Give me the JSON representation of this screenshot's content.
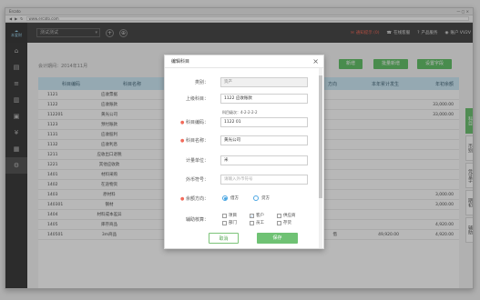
{
  "browser": {
    "tab": "Ercato",
    "url": "www.ercato.com"
  },
  "top": {
    "logo_label": "本爱财",
    "account_select": "测试测试",
    "add_btn": "+",
    "share_btn": "⊕",
    "tools": [
      {
        "label": "通知提示 (0)",
        "color": "red",
        "icon": "bell-icon"
      },
      {
        "label": "在线客服",
        "color": "light",
        "icon": "chat-icon"
      },
      {
        "label": "产品服务",
        "color": "light",
        "icon": "help-icon"
      },
      {
        "label": "账户 VV2V",
        "color": "light",
        "icon": "user-icon"
      }
    ]
  },
  "side": {
    "icons": [
      "home-icon",
      "doc-icon",
      "list-icon",
      "chart-icon",
      "book-icon",
      "money-icon",
      "gift-icon",
      "setting-icon"
    ]
  },
  "main": {
    "period": "会计期间：2014年11月",
    "buttons": [
      {
        "label": "新增"
      },
      {
        "label": "批量新增"
      },
      {
        "label": "设置字段"
      }
    ],
    "headers": [
      "科目编码",
      "科目名称",
      "方向",
      "本年累计发生",
      "年初余额"
    ],
    "rows": [
      {
        "code": "1121",
        "name": "应收票据",
        "dir": "",
        "ytd": "",
        "open": ""
      },
      {
        "code": "1122",
        "name": "应收账款",
        "dir": "",
        "ytd": "",
        "open": "33,000.00"
      },
      {
        "code": "112201",
        "name": "黄光公司",
        "dir": "",
        "ytd": "",
        "open": "33,000.00"
      },
      {
        "code": "1123",
        "name": "预付账款",
        "dir": "",
        "ytd": "",
        "open": ""
      },
      {
        "code": "1131",
        "name": "应收股利",
        "dir": "",
        "ytd": "",
        "open": ""
      },
      {
        "code": "1132",
        "name": "应收利息",
        "dir": "",
        "ytd": "",
        "open": ""
      },
      {
        "code": "1211",
        "name": "应收出口退税",
        "dir": "",
        "ytd": "",
        "open": ""
      },
      {
        "code": "1221",
        "name": "其他应收款",
        "dir": "",
        "ytd": "",
        "open": ""
      },
      {
        "code": "1401",
        "name": "材料采购",
        "dir": "",
        "ytd": "",
        "open": ""
      },
      {
        "code": "1402",
        "name": "在途物资",
        "dir": "",
        "ytd": "",
        "open": ""
      },
      {
        "code": "1403",
        "name": "原材料",
        "dir": "",
        "ytd": "",
        "open": "3,000.00"
      },
      {
        "code": "140301",
        "name": "钢材",
        "dir": "",
        "ytd": "",
        "open": "3,000.00"
      },
      {
        "code": "1404",
        "name": "材料成本差异",
        "dir": "",
        "ytd": "",
        "open": ""
      },
      {
        "code": "1405",
        "name": "库存商品",
        "dir": "",
        "ytd": "",
        "open": "4,920.00"
      },
      {
        "code": "140501",
        "name": "3m商品",
        "dir": "借",
        "ytd": "49,920.00",
        "open": "4,920.00"
      }
    ],
    "right_tabs": [
      "科目",
      "币别",
      "凭证字",
      "期初",
      "辅助"
    ]
  },
  "dialog": {
    "title": "编辑科目",
    "close": "×",
    "type_label": "类别：",
    "type_value": "资产",
    "parent_label": "上级科目：",
    "parent_value": "1122 应收账款",
    "rule_hint": "科目级次：4-2-2-2-2",
    "code_label": "科目编码：",
    "code_value": "1122 01",
    "name_label": "科目名称：",
    "name_value": "黄光公司",
    "unit_label": "计量单位：",
    "unit_value": "米",
    "foreign_label": "外币符号：",
    "foreign_placeholder": "请输入外币符号",
    "dir_label": "余额方向：",
    "dir_options": [
      {
        "label": "借方",
        "on": true
      },
      {
        "label": "贷方",
        "on": false
      }
    ],
    "aux_label": "辅助核算：",
    "aux_options": [
      {
        "label": "项目",
        "checked": false
      },
      {
        "label": "客户",
        "checked": true
      },
      {
        "label": "供应商",
        "checked": false
      },
      {
        "label": "部门",
        "checked": false
      },
      {
        "label": "员工",
        "checked": false
      },
      {
        "label": "存货",
        "checked": false
      }
    ],
    "cancel": "取消",
    "save": "保存"
  }
}
